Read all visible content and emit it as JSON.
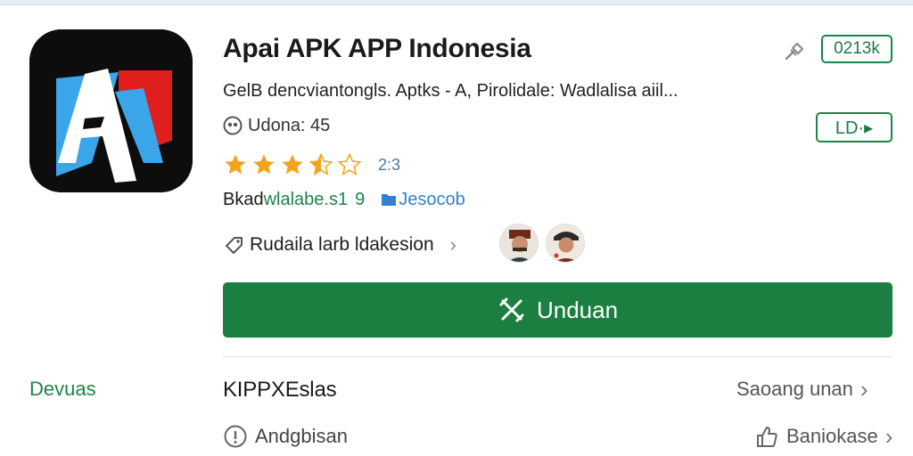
{
  "app": {
    "title": "Apai APK APP Indonesia",
    "subtitle": "GelB dencviantongls. Aptks - A, Pirolidale: Wadlalisa aiil...",
    "developer_label": "Udona: 45",
    "rating": {
      "value": "2:3",
      "stars": 3.5,
      "max_stars": 5
    },
    "meta": {
      "part_a": "Bkad",
      "part_b": "wlalabe.s1",
      "part_c": "9",
      "part_d": "Jesocob"
    },
    "friends_label": "Rudaila larb ldakesion"
  },
  "badges": {
    "count": "0213k",
    "ld": "LD·▸"
  },
  "install_button": {
    "label": "Unduan",
    "icon": "tools-cross-icon"
  },
  "section": {
    "side_label": "Devuas",
    "title": "KIPPXEslas",
    "see_more": "Saoang unan",
    "info_label": "Andgbisan",
    "report_label": "Baniokase"
  },
  "colors": {
    "primary_green": "#1b7f42",
    "accent_blue": "#2f82d0",
    "star_orange": "#f4a31f",
    "icon_blue": "#3aa5e8",
    "icon_red": "#e01e1e"
  }
}
